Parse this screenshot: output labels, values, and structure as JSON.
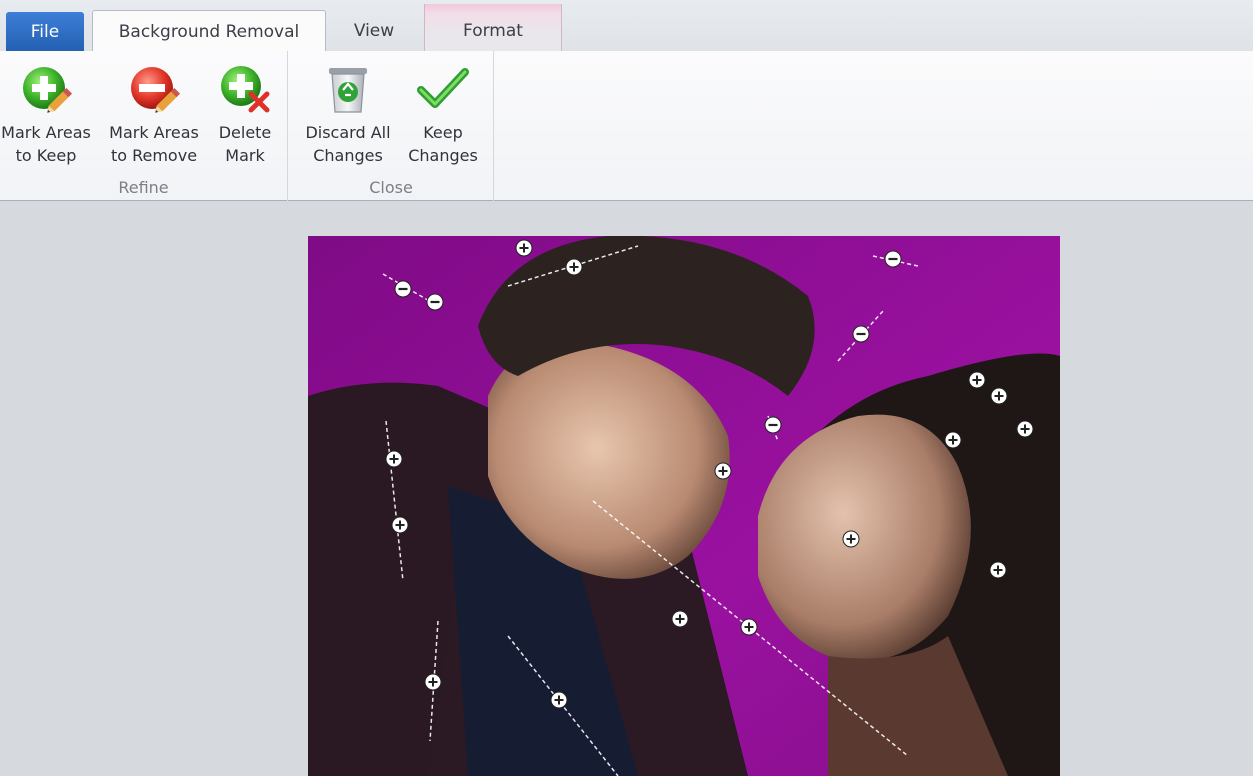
{
  "tabs": {
    "file": "File",
    "background_removal": "Background Removal",
    "view": "View",
    "format": "Format"
  },
  "ribbon": {
    "refine": {
      "label": "Refine",
      "mark_keep": {
        "line1": "Mark Areas",
        "line2": "to Keep",
        "icon": "plus-pencil-icon"
      },
      "mark_remove": {
        "line1": "Mark Areas",
        "line2": "to Remove",
        "icon": "minus-pencil-icon"
      },
      "delete_mark": {
        "line1": "Delete",
        "line2": "Mark",
        "icon": "plus-delete-icon"
      }
    },
    "close": {
      "label": "Close",
      "discard": {
        "line1": "Discard All",
        "line2": "Changes",
        "icon": "recycle-bin-icon"
      },
      "keep": {
        "line1": "Keep",
        "line2": "Changes",
        "icon": "checkmark-icon"
      }
    }
  },
  "colors": {
    "file_tab": "#2a66bb",
    "background": "#8d0d8e",
    "workspace": "#d6d9de"
  }
}
